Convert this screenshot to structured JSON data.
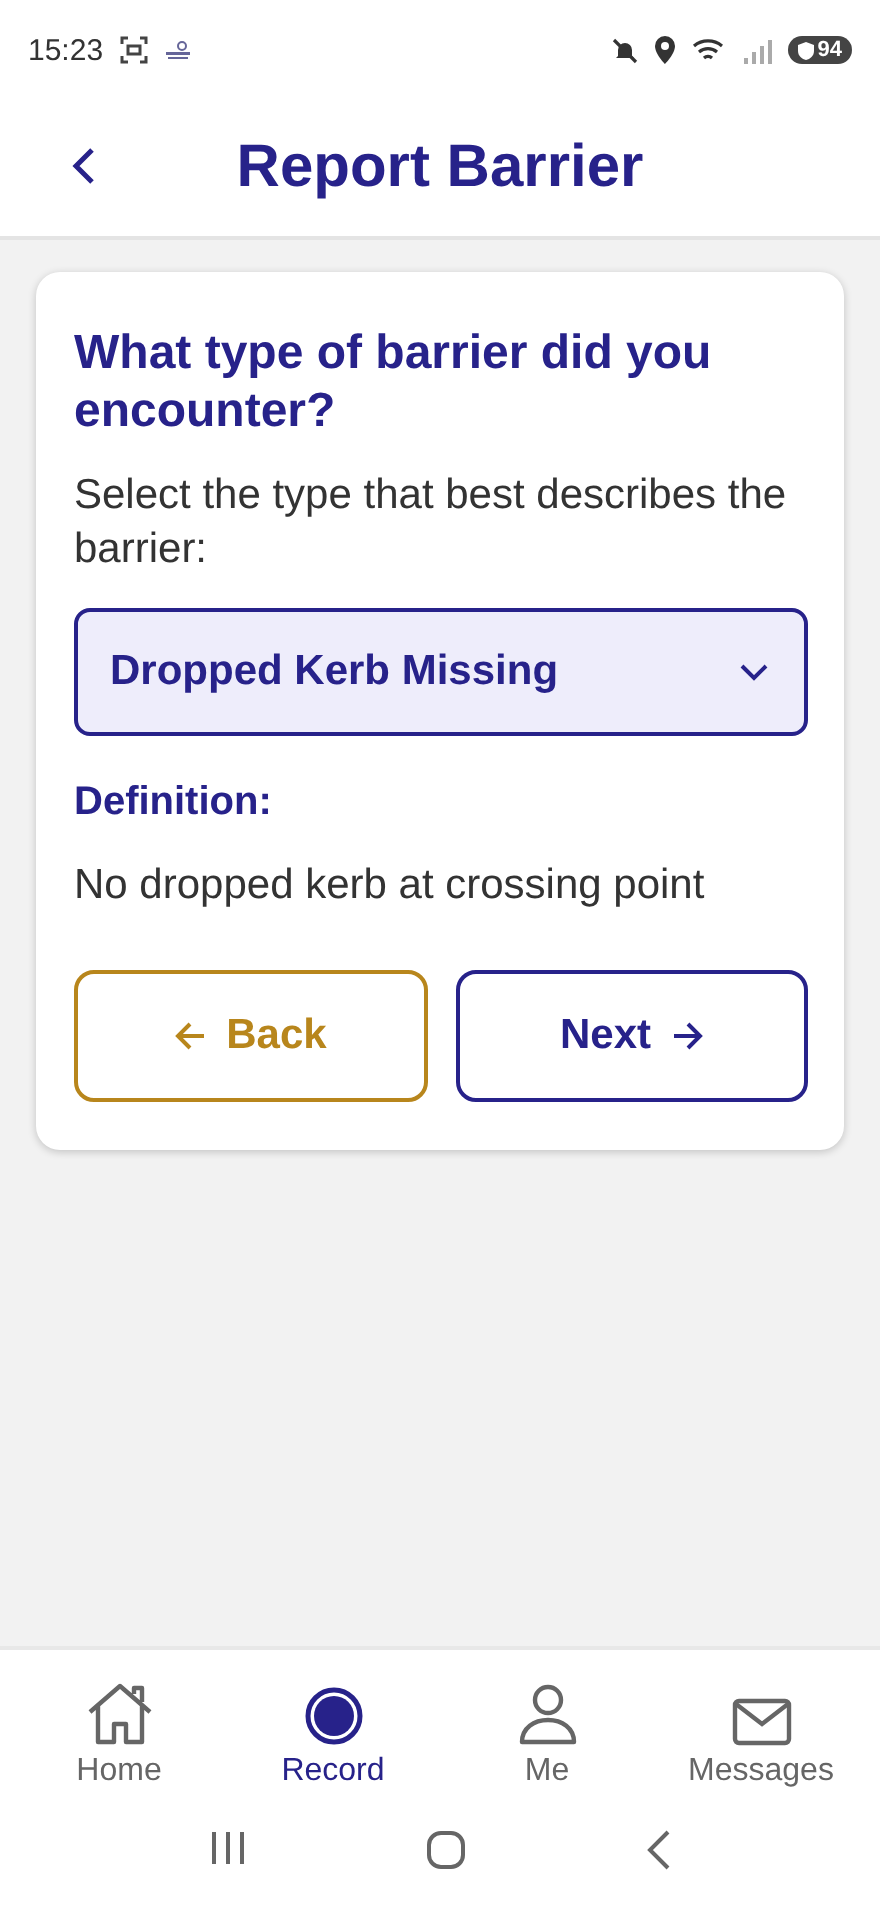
{
  "status_bar": {
    "time": "15:23",
    "battery": "94"
  },
  "header": {
    "title": "Report Barrier"
  },
  "card": {
    "question": "What type of barrier did you encounter?",
    "instruction": "Select the type that best describes the barrier:",
    "dropdown": {
      "value": "Dropped Kerb Missing"
    },
    "definition_label": "Definition:",
    "definition": "No dropped kerb at crossing point",
    "buttons": [
      {
        "kind": "back",
        "label": "Back"
      },
      {
        "kind": "next",
        "label": "Next"
      }
    ]
  },
  "bottom_nav": [
    {
      "kind": "home",
      "label": "Home",
      "selected": false
    },
    {
      "kind": "record",
      "label": "Record",
      "selected": true
    },
    {
      "kind": "me",
      "label": "Me",
      "selected": false
    },
    {
      "kind": "messages",
      "label": "Messages",
      "selected": false
    }
  ]
}
